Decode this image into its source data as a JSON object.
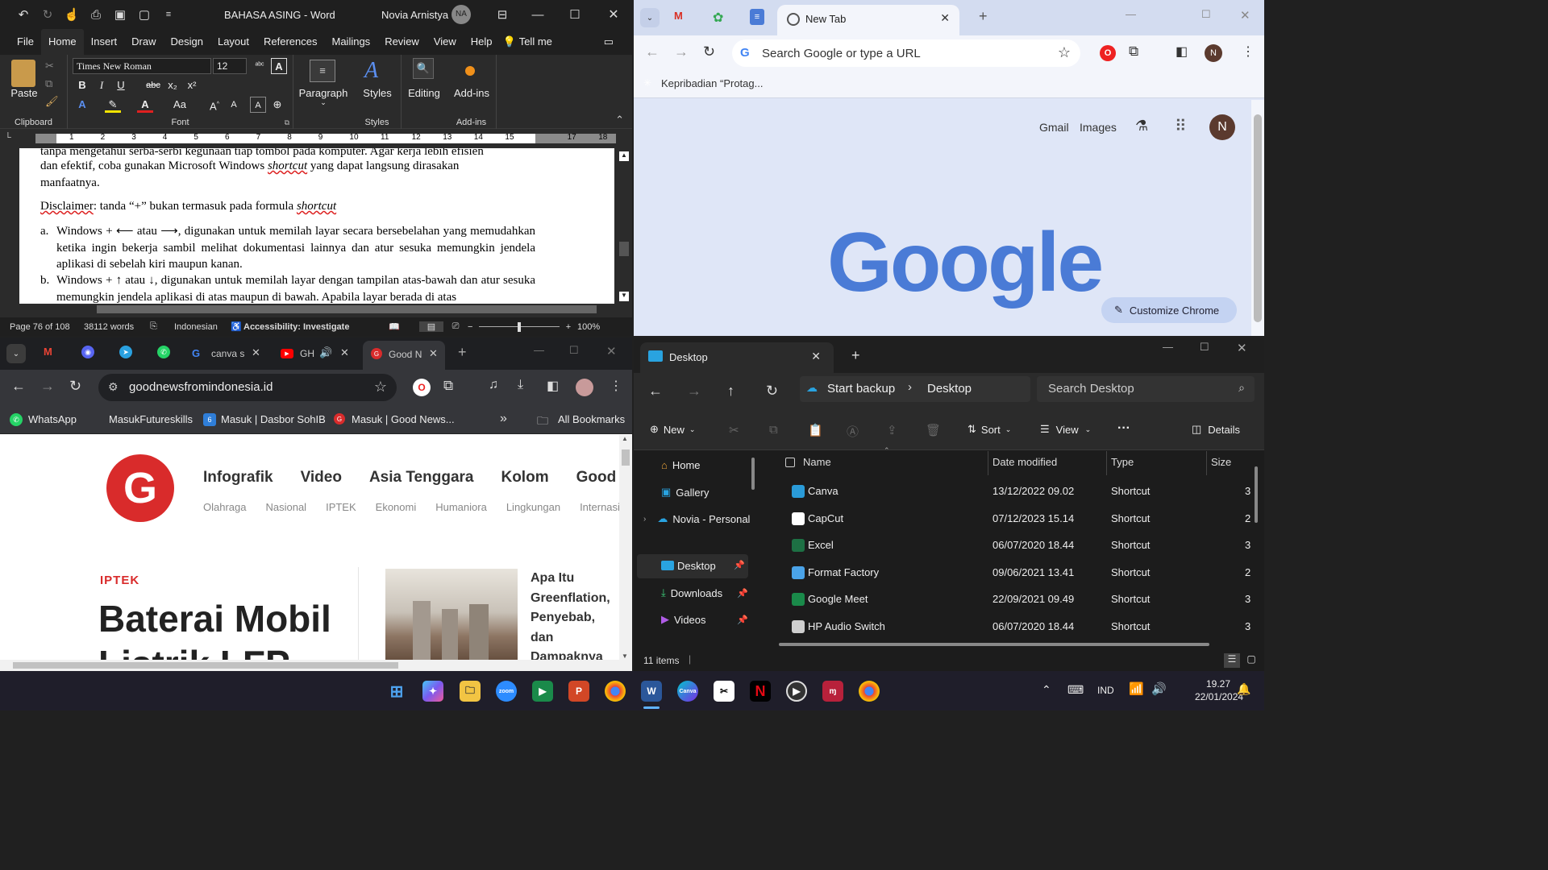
{
  "word": {
    "title": "BAHASA ASING",
    "app": "Word",
    "user": "Novia Arnistya",
    "initials": "NA",
    "menu": [
      "File",
      "Home",
      "Insert",
      "Draw",
      "Design",
      "Layout",
      "References",
      "Mailings",
      "Review",
      "View",
      "Help"
    ],
    "tell_me": "Tell me",
    "ribbon": {
      "paste": "Paste",
      "clipboard": "Clipboard",
      "font_name": "Times New Roman",
      "font_size": "12",
      "font": "Font",
      "paragraph": "Paragraph",
      "styles": "Styles",
      "editing": "Editing",
      "addins": "Add-ins",
      "styles_group": "Styles",
      "addins_group": "Add-ins",
      "b": "B",
      "i": "I",
      "u": "U",
      "strike": "abc",
      "sub": "x₂",
      "sup": "x²",
      "case": "Aa"
    },
    "ruler": [
      "1",
      "2",
      "3",
      "4",
      "5",
      "6",
      "7",
      "8",
      "9",
      "10",
      "11",
      "12",
      "13",
      "14",
      "15",
      "",
      "17",
      "18"
    ],
    "doc": {
      "line0": "tanpa mengetahui serba-serbi kegunaan tiap tombol pada komputer. Agar kerja lebih efisien",
      "line1a": "dan efektif, coba gunakan Microsoft Windows ",
      "line1b": "shortcut",
      "line1c": " yang dapat langsung dirasakan",
      "line2": "manfaatnya.",
      "disc_a": "Disclaimer",
      "disc_b": ": tanda “+” bukan termasuk pada formula ",
      "disc_c": "shortcut",
      "item_a_label": "a.",
      "item_a": "Windows + ⟵ atau ⟶, digunakan untuk memilah layar secara bersebelahan yang memudahkan ketika ingin bekerja sambil melihat dokumentasi lainnya dan atur sesuka memungkin jendela aplikasi di sebelah kiri maupun kanan.",
      "item_b_label": "b.",
      "item_b": "Windows + ↑ atau ↓, digunakan untuk memilah layar dengan tampilan atas-bawah dan atur sesuka memungkin jendela aplikasi di atas maupun di bawah. Apabila layar berada di atas"
    },
    "status": {
      "page": "Page 76 of 108",
      "words": "38112 words",
      "lang": "Indonesian",
      "access": "Accessibility: Investigate",
      "zoom": "100%"
    }
  },
  "chrome_top": {
    "tab_title": "New Tab",
    "omnibox_placeholder": "Search Google or type a URL",
    "profile": "N",
    "bookmark": "Kepribadian “Protag...",
    "gmail": "Gmail",
    "images": "Images",
    "logo": "Google",
    "customize": "Customize Chrome",
    "accent": "#4a7bd6"
  },
  "chrome_bottom": {
    "tabs": [
      "canva s",
      "GH",
      "Good N"
    ],
    "url": "goodnewsfromindonesia.id",
    "bookmarks": [
      "WhatsApp",
      "MasukFutureskills",
      "Masuk | Dasbor SohIB",
      "Masuk | Good News..."
    ],
    "all_bookmarks": "All Bookmarks",
    "nav_main": [
      "Infografik",
      "Video",
      "Asia Tenggara",
      "Kolom",
      "Good N"
    ],
    "nav_sub": [
      "Olahraga",
      "Nasional",
      "IPTEK",
      "Ekonomi",
      "Humaniora",
      "Lingkungan",
      "Internasion"
    ],
    "category": "IPTEK",
    "headline1": "Baterai Mobil",
    "headline2": "Listrik LFP",
    "side_title": [
      "Apa Itu",
      "Greenflation,",
      "Penyebab,",
      "dan",
      "Dampaknya"
    ],
    "accent": "#d92b2b"
  },
  "explorer": {
    "tab_title": "Desktop",
    "backup": "Start backup",
    "crumb": "Desktop",
    "search_placeholder": "Search Desktop",
    "cmd": {
      "new": "New",
      "sort": "Sort",
      "view": "View",
      "details": "Details"
    },
    "nav": [
      "Home",
      "Gallery",
      "Novia - Personal",
      "Desktop",
      "Downloads",
      "Videos"
    ],
    "columns": [
      "Name",
      "Date modified",
      "Type",
      "Size"
    ],
    "rows": [
      {
        "name": "Canva",
        "date": "13/12/2022 09.02",
        "type": "Shortcut",
        "size": "3"
      },
      {
        "name": "CapCut",
        "date": "07/12/2023 15.14",
        "type": "Shortcut",
        "size": "2"
      },
      {
        "name": "Excel",
        "date": "06/07/2020 18.44",
        "type": "Shortcut",
        "size": "3"
      },
      {
        "name": "Format Factory",
        "date": "09/06/2021 13.41",
        "type": "Shortcut",
        "size": "2"
      },
      {
        "name": "Google Meet",
        "date": "22/09/2021 09.49",
        "type": "Shortcut",
        "size": "3"
      },
      {
        "name": "HP Audio Switch",
        "date": "06/07/2020 18.44",
        "type": "Shortcut",
        "size": "3"
      }
    ],
    "items": "11 items"
  },
  "taskbar": {
    "lang": "IND",
    "time": "19.27",
    "date": "22/01/2024"
  }
}
